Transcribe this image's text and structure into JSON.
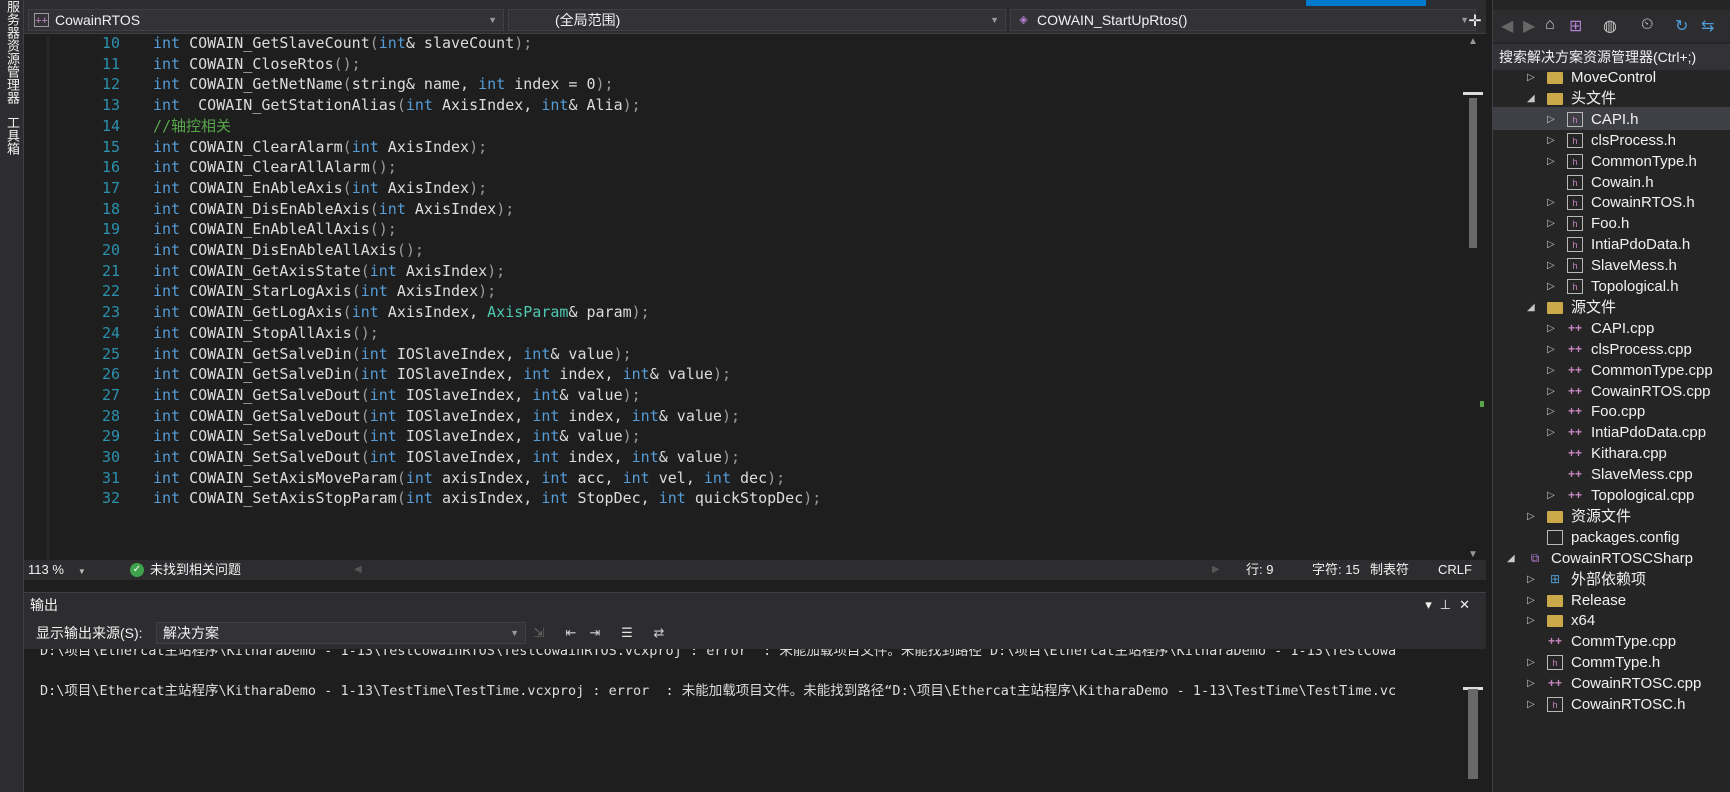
{
  "left_tabs": [
    "服务器资源管理器",
    "工具箱"
  ],
  "navbar": {
    "project": "CowainRTOS",
    "scope": "(全局范围)",
    "function": "COWAIN_StartUpRtos()",
    "split_icon": "split-icon"
  },
  "code_lines": [
    {
      "n": "10",
      "parts": [
        [
          "kw",
          "int"
        ],
        [
          "fn",
          " COWAIN_GetSlaveCount"
        ],
        [
          "par",
          "("
        ],
        [
          "kw",
          "int"
        ],
        [
          "fn",
          "& slaveCount"
        ],
        [
          "par",
          ");"
        ]
      ]
    },
    {
      "n": "11",
      "parts": [
        [
          "kw",
          "int"
        ],
        [
          "fn",
          " COWAIN_CloseRtos"
        ],
        [
          "par",
          "();"
        ]
      ]
    },
    {
      "n": "12",
      "parts": [
        [
          "kw",
          "int"
        ],
        [
          "fn",
          " COWAIN_GetNetName"
        ],
        [
          "par",
          "("
        ],
        [
          "fn",
          "string& name, "
        ],
        [
          "kw",
          "int"
        ],
        [
          "fn",
          " index = 0"
        ],
        [
          "par",
          ");"
        ]
      ]
    },
    {
      "n": "13",
      "parts": [
        [
          "kw",
          "int"
        ],
        [
          "fn",
          "  COWAIN_GetStationAlias"
        ],
        [
          "par",
          "("
        ],
        [
          "kw",
          "int"
        ],
        [
          "fn",
          " AxisIndex, "
        ],
        [
          "kw",
          "int"
        ],
        [
          "fn",
          "& Alia"
        ],
        [
          "par",
          ");"
        ]
      ]
    },
    {
      "n": "14",
      "parts": [
        [
          "cm",
          "//轴控相关"
        ]
      ]
    },
    {
      "n": "15",
      "parts": [
        [
          "kw",
          "int"
        ],
        [
          "fn",
          " COWAIN_ClearAlarm"
        ],
        [
          "par",
          "("
        ],
        [
          "kw",
          "int"
        ],
        [
          "fn",
          " AxisIndex"
        ],
        [
          "par",
          ");"
        ]
      ]
    },
    {
      "n": "16",
      "parts": [
        [
          "kw",
          "int"
        ],
        [
          "fn",
          " COWAIN_ClearAllAlarm"
        ],
        [
          "par",
          "();"
        ]
      ]
    },
    {
      "n": "17",
      "parts": [
        [
          "kw",
          "int"
        ],
        [
          "fn",
          " COWAIN_EnAbleAxis"
        ],
        [
          "par",
          "("
        ],
        [
          "kw",
          "int"
        ],
        [
          "fn",
          " AxisIndex"
        ],
        [
          "par",
          ");"
        ]
      ]
    },
    {
      "n": "18",
      "parts": [
        [
          "kw",
          "int"
        ],
        [
          "fn",
          " COWAIN_DisEnAbleAxis"
        ],
        [
          "par",
          "("
        ],
        [
          "kw",
          "int"
        ],
        [
          "fn",
          " AxisIndex"
        ],
        [
          "par",
          ");"
        ]
      ]
    },
    {
      "n": "19",
      "parts": [
        [
          "kw",
          "int"
        ],
        [
          "fn",
          " COWAIN_EnAbleAllAxis"
        ],
        [
          "par",
          "();"
        ]
      ]
    },
    {
      "n": "20",
      "parts": [
        [
          "kw",
          "int"
        ],
        [
          "fn",
          " COWAIN_DisEnAbleAllAxis"
        ],
        [
          "par",
          "();"
        ]
      ]
    },
    {
      "n": "21",
      "parts": [
        [
          "kw",
          "int"
        ],
        [
          "fn",
          " COWAIN_GetAxisState"
        ],
        [
          "par",
          "("
        ],
        [
          "kw",
          "int"
        ],
        [
          "fn",
          " AxisIndex"
        ],
        [
          "par",
          ");"
        ]
      ]
    },
    {
      "n": "22",
      "parts": [
        [
          "kw",
          "int"
        ],
        [
          "fn",
          " COWAIN_StarLogAxis"
        ],
        [
          "par",
          "("
        ],
        [
          "kw",
          "int"
        ],
        [
          "fn",
          " AxisIndex"
        ],
        [
          "par",
          ");"
        ]
      ]
    },
    {
      "n": "23",
      "parts": [
        [
          "kw",
          "int"
        ],
        [
          "fn",
          " COWAIN_GetLogAxis"
        ],
        [
          "par",
          "("
        ],
        [
          "kw",
          "int"
        ],
        [
          "fn",
          " AxisIndex, "
        ],
        [
          "ty",
          "AxisParam"
        ],
        [
          "fn",
          "& param"
        ],
        [
          "par",
          ");"
        ]
      ]
    },
    {
      "n": "24",
      "parts": [
        [
          "kw",
          "int"
        ],
        [
          "fn",
          " COWAIN_StopAllAxis"
        ],
        [
          "par",
          "();"
        ]
      ]
    },
    {
      "n": "25",
      "parts": [
        [
          "kw",
          "int"
        ],
        [
          "fn",
          " COWAIN_GetSalveDin"
        ],
        [
          "par",
          "("
        ],
        [
          "kw",
          "int"
        ],
        [
          "fn",
          " IOSlaveIndex, "
        ],
        [
          "kw",
          "int"
        ],
        [
          "fn",
          "& value"
        ],
        [
          "par",
          ");"
        ]
      ]
    },
    {
      "n": "26",
      "parts": [
        [
          "kw",
          "int"
        ],
        [
          "fn",
          " COWAIN_GetSalveDin"
        ],
        [
          "par",
          "("
        ],
        [
          "kw",
          "int"
        ],
        [
          "fn",
          " IOSlaveIndex, "
        ],
        [
          "kw",
          "int"
        ],
        [
          "fn",
          " index, "
        ],
        [
          "kw",
          "int"
        ],
        [
          "fn",
          "& value"
        ],
        [
          "par",
          ");"
        ]
      ]
    },
    {
      "n": "27",
      "parts": [
        [
          "kw",
          "int"
        ],
        [
          "fn",
          " COWAIN_GetSalveDout"
        ],
        [
          "par",
          "("
        ],
        [
          "kw",
          "int"
        ],
        [
          "fn",
          " IOSlaveIndex, "
        ],
        [
          "kw",
          "int"
        ],
        [
          "fn",
          "& value"
        ],
        [
          "par",
          ");"
        ]
      ]
    },
    {
      "n": "28",
      "parts": [
        [
          "kw",
          "int"
        ],
        [
          "fn",
          " COWAIN_GetSalveDout"
        ],
        [
          "par",
          "("
        ],
        [
          "kw",
          "int"
        ],
        [
          "fn",
          " IOSlaveIndex, "
        ],
        [
          "kw",
          "int"
        ],
        [
          "fn",
          " index, "
        ],
        [
          "kw",
          "int"
        ],
        [
          "fn",
          "& value"
        ],
        [
          "par",
          ");"
        ]
      ]
    },
    {
      "n": "29",
      "parts": [
        [
          "kw",
          "int"
        ],
        [
          "fn",
          " COWAIN_SetSalveDout"
        ],
        [
          "par",
          "("
        ],
        [
          "kw",
          "int"
        ],
        [
          "fn",
          " IOSlaveIndex, "
        ],
        [
          "kw",
          "int"
        ],
        [
          "fn",
          "& value"
        ],
        [
          "par",
          ");"
        ]
      ]
    },
    {
      "n": "30",
      "parts": [
        [
          "kw",
          "int"
        ],
        [
          "fn",
          " COWAIN_SetSalveDout"
        ],
        [
          "par",
          "("
        ],
        [
          "kw",
          "int"
        ],
        [
          "fn",
          " IOSlaveIndex, "
        ],
        [
          "kw",
          "int"
        ],
        [
          "fn",
          " index, "
        ],
        [
          "kw",
          "int"
        ],
        [
          "fn",
          "& value"
        ],
        [
          "par",
          ");"
        ]
      ]
    },
    {
      "n": "31",
      "parts": [
        [
          "kw",
          "int"
        ],
        [
          "fn",
          " COWAIN_SetAxisMoveParam"
        ],
        [
          "par",
          "("
        ],
        [
          "kw",
          "int"
        ],
        [
          "fn",
          " axisIndex, "
        ],
        [
          "kw",
          "int"
        ],
        [
          "fn",
          " acc, "
        ],
        [
          "kw",
          "int"
        ],
        [
          "fn",
          " vel, "
        ],
        [
          "kw",
          "int"
        ],
        [
          "fn",
          " dec"
        ],
        [
          "par",
          ");"
        ]
      ]
    },
    {
      "n": "32",
      "parts": [
        [
          "kw",
          "int"
        ],
        [
          "fn",
          " COWAIN_SetAxisStopParam"
        ],
        [
          "par",
          "("
        ],
        [
          "kw",
          "int"
        ],
        [
          "fn",
          " axisIndex, "
        ],
        [
          "kw",
          "int"
        ],
        [
          "fn",
          " StopDec, "
        ],
        [
          "kw",
          "int"
        ],
        [
          "fn",
          " quickStopDec"
        ],
        [
          "par",
          ");"
        ]
      ]
    }
  ],
  "status": {
    "zoom": "113 %",
    "issues": "未找到相关问题",
    "line": "行: 9",
    "char": "字符: 15",
    "tab": "制表符",
    "eol": "CRLF"
  },
  "output": {
    "title": "输出",
    "source_label": "显示输出来源(S):",
    "source_value": "解决方案",
    "lines": [
      "D:\\项目\\Ethercat主站程序\\KitharaDemo - 1-13\\TestCowainRTOS\\TestCowainRTOS.vcxproj : error  : 未能加载项目文件。未能找到路径“D:\\项目\\Ethercat主站程序\\KitharaDemo - 1-13\\TestCowa",
      "D:\\项目\\Ethercat主站程序\\KitharaDemo - 1-13\\TestTime\\TestTime.vcxproj : error  : 未能加载项目文件。未能找到路径“D:\\项目\\Ethercat主站程序\\KitharaDemo - 1-13\\TestTime\\TestTime.vc"
    ]
  },
  "solution": {
    "search_placeholder": "搜索解决方案资源管理器(Ctrl+;)",
    "items": [
      {
        "label": "MoveControl",
        "indent": 1,
        "expander": "▷",
        "icon": "folder"
      },
      {
        "label": "头文件",
        "indent": 1,
        "expander": "◢",
        "icon": "folder"
      },
      {
        "label": "CAPI.h",
        "indent": 2,
        "expander": "▷",
        "icon": "h",
        "selected": true
      },
      {
        "label": "clsProcess.h",
        "indent": 2,
        "expander": "▷",
        "icon": "h"
      },
      {
        "label": "CommonType.h",
        "indent": 2,
        "expander": "▷",
        "icon": "h"
      },
      {
        "label": "Cowain.h",
        "indent": 2,
        "expander": "",
        "icon": "h"
      },
      {
        "label": "CowainRTOS.h",
        "indent": 2,
        "expander": "▷",
        "icon": "h"
      },
      {
        "label": "Foo.h",
        "indent": 2,
        "expander": "▷",
        "icon": "h"
      },
      {
        "label": "IntiaPdoData.h",
        "indent": 2,
        "expander": "▷",
        "icon": "h"
      },
      {
        "label": "SlaveMess.h",
        "indent": 2,
        "expander": "▷",
        "icon": "h"
      },
      {
        "label": "Topological.h",
        "indent": 2,
        "expander": "▷",
        "icon": "h"
      },
      {
        "label": "源文件",
        "indent": 1,
        "expander": "◢",
        "icon": "folder"
      },
      {
        "label": "CAPI.cpp",
        "indent": 2,
        "expander": "▷",
        "icon": "cpp"
      },
      {
        "label": "clsProcess.cpp",
        "indent": 2,
        "expander": "▷",
        "icon": "cpp"
      },
      {
        "label": "CommonType.cpp",
        "indent": 2,
        "expander": "▷",
        "icon": "cpp"
      },
      {
        "label": "CowainRTOS.cpp",
        "indent": 2,
        "expander": "▷",
        "icon": "cpp"
      },
      {
        "label": "Foo.cpp",
        "indent": 2,
        "expander": "▷",
        "icon": "cpp"
      },
      {
        "label": "IntiaPdoData.cpp",
        "indent": 2,
        "expander": "▷",
        "icon": "cpp"
      },
      {
        "label": "Kithara.cpp",
        "indent": 2,
        "expander": "",
        "icon": "cpp"
      },
      {
        "label": "SlaveMess.cpp",
        "indent": 2,
        "expander": "",
        "icon": "cpp"
      },
      {
        "label": "Topological.cpp",
        "indent": 2,
        "expander": "▷",
        "icon": "cpp"
      },
      {
        "label": "资源文件",
        "indent": 1,
        "expander": "▷",
        "icon": "folder"
      },
      {
        "label": "packages.config",
        "indent": 1,
        "expander": "",
        "icon": "file"
      },
      {
        "label": "CowainRTOSCSharp",
        "indent": 0,
        "expander": "◢",
        "icon": "proj"
      },
      {
        "label": "外部依赖项",
        "indent": 1,
        "expander": "▷",
        "icon": "ref"
      },
      {
        "label": "Release",
        "indent": 1,
        "expander": "▷",
        "icon": "folder"
      },
      {
        "label": "x64",
        "indent": 1,
        "expander": "▷",
        "icon": "folder"
      },
      {
        "label": "CommType.cpp",
        "indent": 1,
        "expander": "",
        "icon": "cpp"
      },
      {
        "label": "CommType.h",
        "indent": 1,
        "expander": "▷",
        "icon": "h"
      },
      {
        "label": "CowainRTOSC.cpp",
        "indent": 1,
        "expander": "▷",
        "icon": "cpp"
      },
      {
        "label": "CowainRTOSC.h",
        "indent": 1,
        "expander": "▷",
        "icon": "h"
      }
    ]
  },
  "colors": {
    "background": "#1e1e1e",
    "panel": "#2d2d30",
    "keyword": "#569cd6",
    "comment": "#57a64a",
    "type": "#4ec9b0",
    "line_number": "#2b91af",
    "accent": "#007acc"
  }
}
